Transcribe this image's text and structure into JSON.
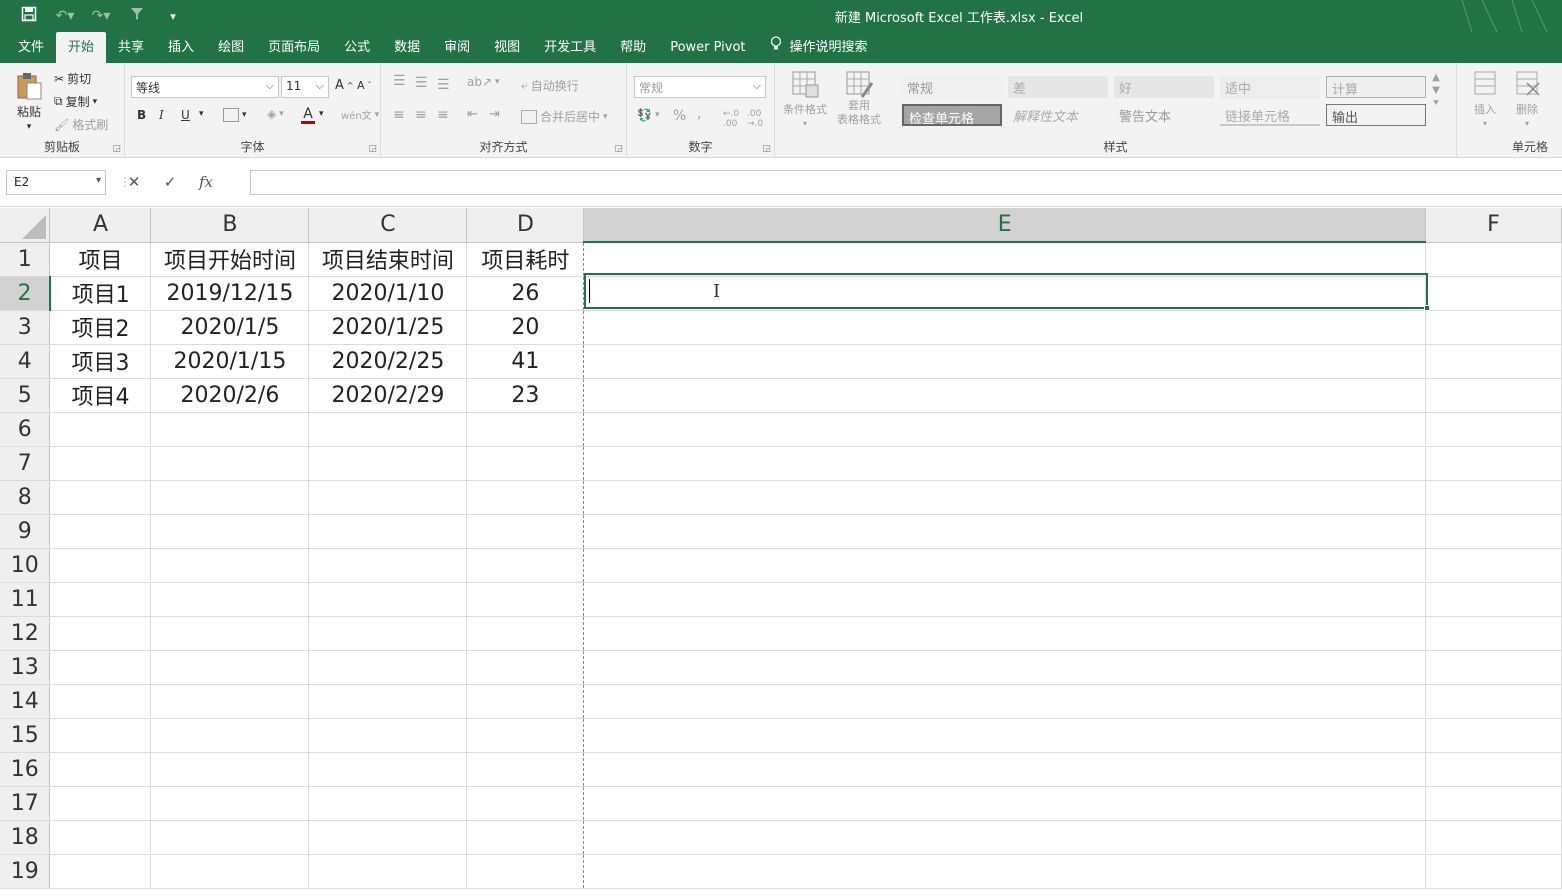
{
  "window": {
    "title": "新建 Microsoft Excel 工作表.xlsx  -  Excel"
  },
  "ribbon_tabs": [
    "文件",
    "开始",
    "共享",
    "插入",
    "绘图",
    "页面布局",
    "公式",
    "数据",
    "审阅",
    "视图",
    "开发工具",
    "帮助",
    "Power Pivot"
  ],
  "active_tab": "开始",
  "tell_me": "操作说明搜索",
  "clipboard": {
    "paste": "粘贴",
    "cut": "剪切",
    "copy": "复制",
    "format_painter": "格式刷",
    "label": "剪贴板"
  },
  "font": {
    "name": "等线",
    "size": "11",
    "label": "字体",
    "bold": "B",
    "italic": "I",
    "underline": "U"
  },
  "alignment": {
    "wrap_text": "自动换行",
    "merge_center": "合并后居中",
    "label": "对齐方式"
  },
  "number": {
    "format": "常规",
    "percent": "%",
    "comma": ",",
    "label": "数字"
  },
  "styles": {
    "conditional_format": "条件格式",
    "table_format_1": "套用",
    "table_format_2": "表格格式",
    "cells": [
      "常规",
      "差",
      "好",
      "适中",
      "计算",
      "检查单元格",
      "解释性文本",
      "警告文本",
      "链接单元格",
      "输出"
    ],
    "label": "样式"
  },
  "cells_group": {
    "insert": "插入",
    "delete": "删除",
    "label": "单元格"
  },
  "formula_bar": {
    "name_box": "E2",
    "cancel": "✕",
    "enter": "✓",
    "fx": "fx",
    "content": ""
  },
  "sheet": {
    "columns": [
      "A",
      "B",
      "C",
      "D",
      "E",
      "F"
    ],
    "selected_column": "E",
    "selected_row": 2,
    "rows": [
      [
        "项目",
        "项目开始时间",
        "项目结束时间",
        "项目耗时",
        "",
        ""
      ],
      [
        "项目1",
        "2019/12/15",
        "2020/1/10",
        "26",
        "",
        ""
      ],
      [
        "项目2",
        "2020/1/5",
        "2020/1/25",
        "20",
        "",
        ""
      ],
      [
        "项目3",
        "2020/1/15",
        "2020/2/25",
        "41",
        "",
        ""
      ],
      [
        "项目4",
        "2020/2/6",
        "2020/2/29",
        "23",
        "",
        ""
      ],
      [
        "",
        "",
        "",
        "",
        "",
        ""
      ],
      [
        "",
        "",
        "",
        "",
        "",
        ""
      ],
      [
        "",
        "",
        "",
        "",
        "",
        ""
      ],
      [
        "",
        "",
        "",
        "",
        "",
        ""
      ],
      [
        "",
        "",
        "",
        "",
        "",
        ""
      ],
      [
        "",
        "",
        "",
        "",
        "",
        ""
      ],
      [
        "",
        "",
        "",
        "",
        "",
        ""
      ],
      [
        "",
        "",
        "",
        "",
        "",
        ""
      ],
      [
        "",
        "",
        "",
        "",
        "",
        ""
      ],
      [
        "",
        "",
        "",
        "",
        "",
        ""
      ],
      [
        "",
        "",
        "",
        "",
        "",
        ""
      ],
      [
        "",
        "",
        "",
        "",
        "",
        ""
      ],
      [
        "",
        "",
        "",
        "",
        "",
        ""
      ],
      [
        "",
        "",
        "",
        "",
        "",
        ""
      ]
    ],
    "row_numbers": [
      "1",
      "2",
      "3",
      "4",
      "5",
      "6",
      "7",
      "8",
      "9",
      "10",
      "11",
      "12",
      "13",
      "14",
      "15",
      "16",
      "17",
      "18",
      "19"
    ]
  },
  "colors": {
    "accent": "#217346",
    "ribbon_bg": "#f3f3f3"
  }
}
